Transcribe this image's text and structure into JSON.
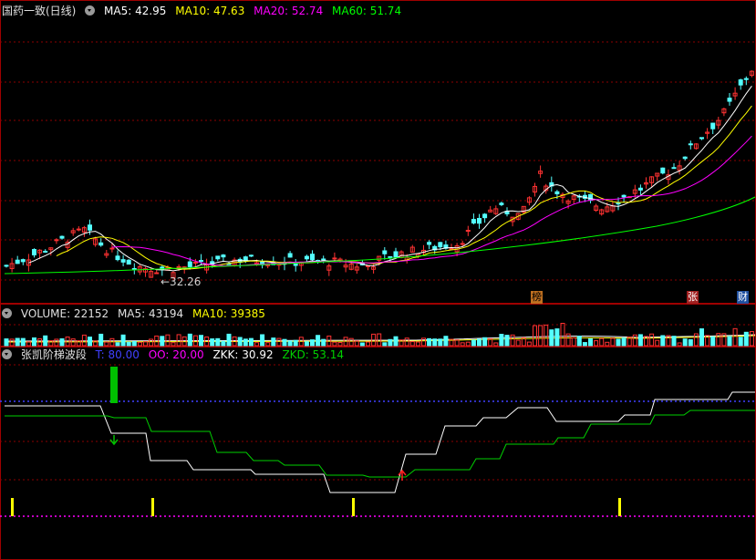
{
  "main_panel": {
    "stock_label": "国药一致(日线)",
    "ma": [
      {
        "label": "MA5: 42.95",
        "color": "#ffffff"
      },
      {
        "label": "MA10: 47.63",
        "color": "#ffff00"
      },
      {
        "label": "MA20: 52.74",
        "color": "#ff00ff"
      },
      {
        "label": "MA60: 51.74",
        "color": "#00ff00"
      }
    ],
    "low_annotation": "←32.26",
    "event_tags": [
      {
        "label": "榜",
        "bg": "#c07020",
        "color": "#000000"
      },
      {
        "label": "张",
        "bg": "#a02020",
        "color": "#ffffff"
      },
      {
        "label": "财",
        "bg": "#2050a0",
        "color": "#ffffff"
      }
    ]
  },
  "volume_panel": {
    "volume_label": "VOLUME: 22152",
    "ma5_label": "MA5: 43194",
    "ma10_label": "MA10: 39385"
  },
  "indicator_panel": {
    "name": "张凯阶梯波段",
    "t_label": "T: 80.00",
    "oo_label": "OO: 20.00",
    "zkk_label": "ZKK: 30.92",
    "zkd_label": "ZKD: 53.14"
  },
  "colors": {
    "up": "#ff3232",
    "down": "#54ffff",
    "grid": "#8b0000",
    "border": "#a00000",
    "ma5": "#ffffff",
    "ma10": "#ffff00",
    "ma20": "#ff00ff",
    "ma60": "#00ff00",
    "zkk": "#ffffff",
    "zkd": "#00d000",
    "t_line": "#4040ff",
    "oo_line": "#ff00ff",
    "signal": "#ffff00"
  },
  "chart_data": [
    {
      "type": "candlestick",
      "title": "国药一致(日线)",
      "low_marker": 32.26,
      "series": [
        {
          "name": "MA5",
          "value": 42.95
        },
        {
          "name": "MA10",
          "value": 47.63
        },
        {
          "name": "MA20",
          "value": 52.74
        },
        {
          "name": "MA60",
          "value": 51.74
        }
      ],
      "events": [
        "榜",
        "张",
        "财"
      ]
    },
    {
      "type": "bar",
      "title": "VOLUME",
      "series": [
        {
          "name": "VOLUME",
          "value": 22152
        },
        {
          "name": "MA5",
          "value": 43194
        },
        {
          "name": "MA10",
          "value": 39385
        }
      ]
    },
    {
      "type": "line",
      "title": "张凯阶梯波段",
      "series": [
        {
          "name": "T",
          "value": 80.0
        },
        {
          "name": "OO",
          "value": 20.0
        },
        {
          "name": "ZKK",
          "value": 30.92
        },
        {
          "name": "ZKD",
          "value": 53.14
        }
      ]
    }
  ]
}
